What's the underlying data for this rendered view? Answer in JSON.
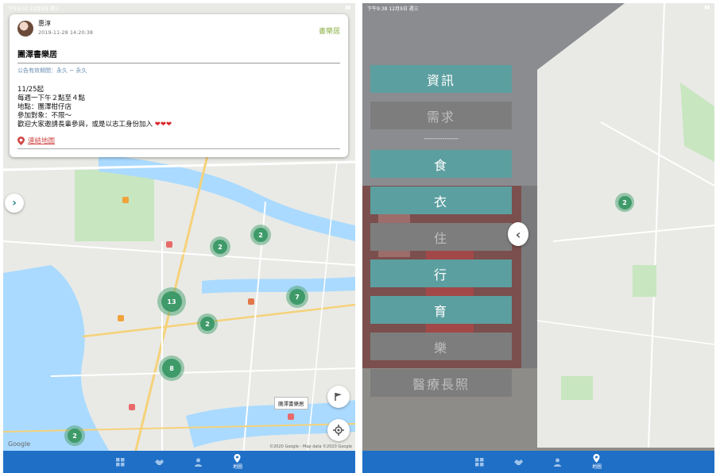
{
  "left": {
    "status_left": "下午9:37  12月9日 週三",
    "card": {
      "author": "惠淳",
      "posted_at": "2019-11-28 14:20:38",
      "tag": "書樂居",
      "title": "團澤書樂居",
      "validity": "公告有效期間：永久 ~ 永久",
      "body": "11/25起\n每週一下午２點至４點\n地點：團澤柑仔店\n參加對象：不限～\n歡迎大家邀請長輩參與，或是以志工身份加入",
      "hearts": "❤❤❤",
      "link_label": "連結地圖"
    },
    "clusters": [
      "2",
      "2",
      "13",
      "7",
      "2",
      "8",
      "2"
    ],
    "tooltip": "團澤書樂居",
    "google": "Google",
    "copyright": "©2020 Google - Map data ©2020 Google"
  },
  "right": {
    "status_left": "下午9:38  12月9日 週三",
    "menu": [
      {
        "label": "資訊",
        "active": true
      },
      {
        "label": "需求",
        "active": false
      }
    ],
    "divider": "---------------",
    "categories": [
      {
        "label": "食",
        "active": true
      },
      {
        "label": "衣",
        "active": true
      },
      {
        "label": "住",
        "active": false
      },
      {
        "label": "行",
        "active": true
      },
      {
        "label": "育",
        "active": true
      },
      {
        "label": "樂",
        "active": false
      },
      {
        "label": "醫療長照",
        "active": false
      }
    ],
    "cluster": "2"
  },
  "tabbar": {
    "items": [
      {
        "icon": "grid-icon",
        "label": ""
      },
      {
        "icon": "handshake-icon",
        "label": ""
      },
      {
        "icon": "person-icon",
        "label": ""
      },
      {
        "icon": "map-pin-icon",
        "label": "地圖"
      }
    ]
  },
  "colors": {
    "accent": "#1f6fc6",
    "menu_active": "#5c9fa0",
    "menu_inactive": "#7d7d7d",
    "cluster": "#3f9a6a",
    "tag": "#8fb24a",
    "water": "#aadaff",
    "land": "#e9eae6",
    "green": "#c8e6c0"
  }
}
